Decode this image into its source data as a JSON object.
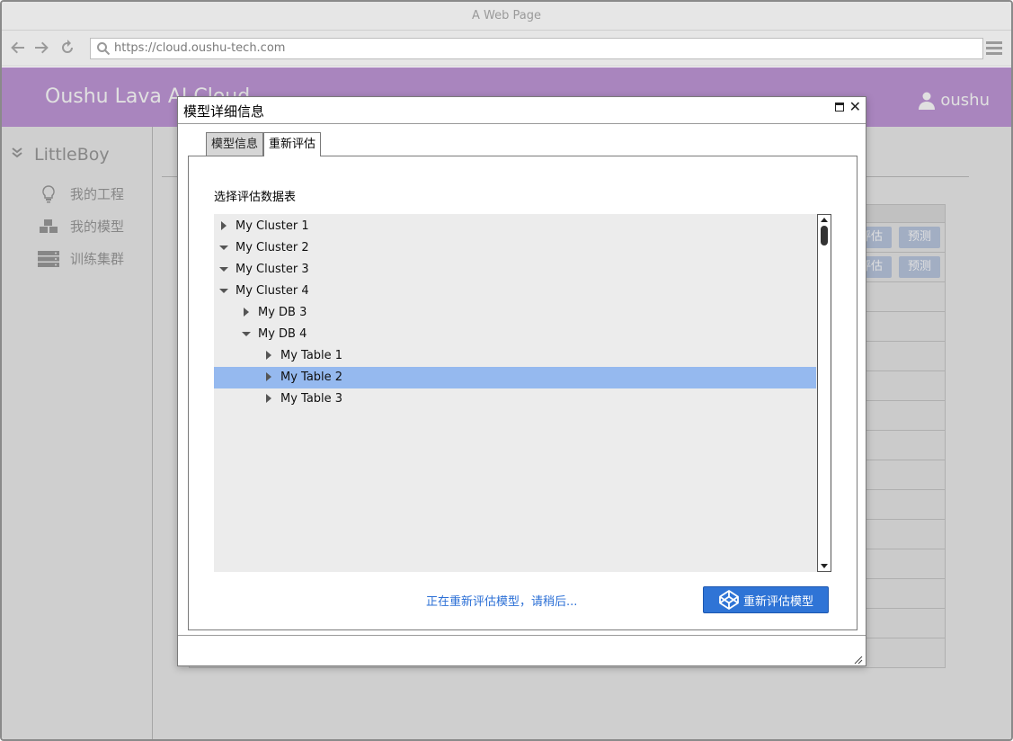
{
  "browser": {
    "window_title": "A Web Page",
    "url": "https://cloud.oushu-tech.com",
    "icons": [
      "arrow-left-icon",
      "arrow-right-icon",
      "refresh-icon",
      "search-icon",
      "menu-icon"
    ]
  },
  "header": {
    "brand": "Oushu Lava AI Cloud",
    "username": "oushu",
    "accent_color": "#c198d9"
  },
  "sidebar": {
    "title": "LittleBoy",
    "items": [
      {
        "label": "我的工程",
        "icon": "lightbulb-icon"
      },
      {
        "label": "我的模型",
        "icon": "cubes-icon"
      },
      {
        "label": "训练集群",
        "icon": "server-icon"
      }
    ]
  },
  "background_table": {
    "buttons": [
      {
        "evaluate": "评估",
        "predict": "预测"
      },
      {
        "evaluate": "评估",
        "predict": "预测"
      }
    ]
  },
  "modal": {
    "title": "模型详细信息",
    "tabs": [
      {
        "label": "模型信息",
        "active": false
      },
      {
        "label": "重新评估",
        "active": true
      }
    ],
    "section_label": "选择评估数据表",
    "tree": [
      {
        "label": "My Cluster 1",
        "level": 0,
        "expanded": false,
        "selected": false
      },
      {
        "label": "My Cluster 2",
        "level": 0,
        "expanded": true,
        "selected": false
      },
      {
        "label": "My Cluster 3",
        "level": 0,
        "expanded": true,
        "selected": false
      },
      {
        "label": "My Cluster 4",
        "level": 0,
        "expanded": true,
        "selected": false
      },
      {
        "label": "My DB 3",
        "level": 1,
        "expanded": false,
        "selected": false
      },
      {
        "label": "My DB 4",
        "level": 1,
        "expanded": true,
        "selected": false
      },
      {
        "label": "My Table 1",
        "level": 2,
        "expanded": false,
        "selected": false
      },
      {
        "label": "My Table 2",
        "level": 2,
        "expanded": false,
        "selected": true
      },
      {
        "label": "My Table 3",
        "level": 2,
        "expanded": false,
        "selected": false
      }
    ],
    "status_text": "正在重新评估模型，请稍后...",
    "submit_button": "重新评估模型",
    "selection_color": "#95b9ef",
    "button_color": "#2f74d6"
  }
}
